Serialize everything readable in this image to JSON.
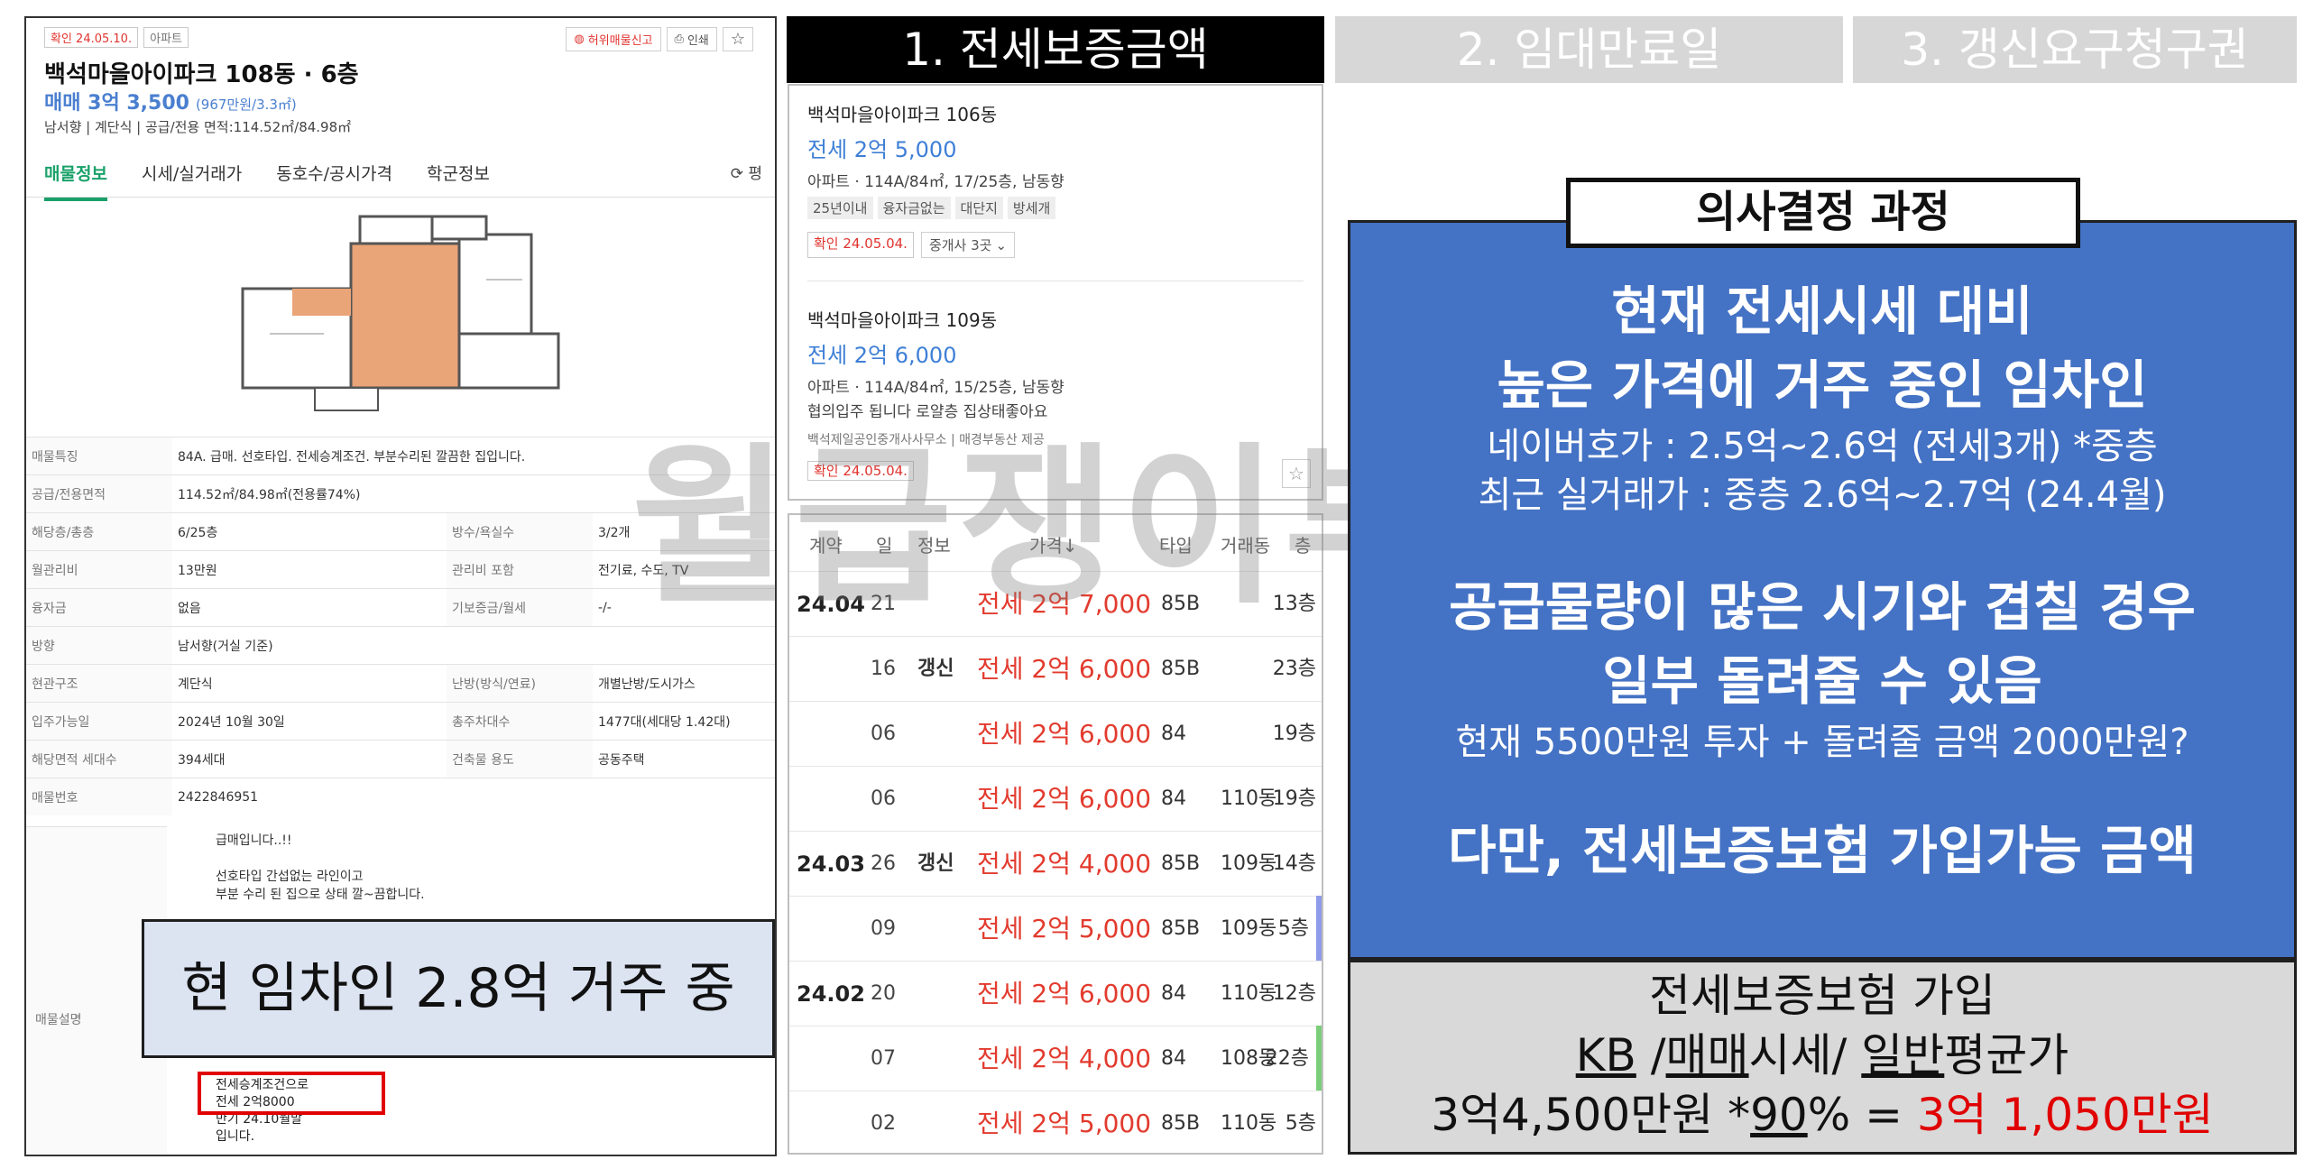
{
  "steps": {
    "s1": "1. 전세보증금액",
    "s2": "2. 임대만료일",
    "s3": "3. 갱신요구청구권"
  },
  "listing": {
    "confirm_tag": "확인 24.05.10.",
    "type_tag": "아파트",
    "report_btn": "허위매물신고",
    "print_btn": "인쇄",
    "title": "백석마을아이파크 108동 · 6층",
    "price_label": "매매 3억 3,500",
    "price_unit": "(967만원/3.3㎡)",
    "summary": "남서향 | 계단식 | 공급/전용 면적:114.52㎡/84.98㎡",
    "tabs": [
      "매물정보",
      "시세/실거래가",
      "동호수/공시가격",
      "학군정보"
    ],
    "tab_right": "평",
    "rows": [
      {
        "k": "매물특징",
        "v": "84A. 급매. 선호타입. 전세승계조건. 부분수리된 깔끔한 집입니다."
      },
      {
        "k": "공급/전용면적",
        "v": "114.52㎡/84.98㎡(전용률74%)"
      },
      {
        "k": "해당층/총층",
        "v": "6/25층",
        "k2": "방수/욕실수",
        "v2": "3/2개"
      },
      {
        "k": "월관리비",
        "v": "13만원",
        "k2": "관리비 포함",
        "v2": "전기료, 수도, TV"
      },
      {
        "k": "융자금",
        "v": "없음",
        "k2": "기보증금/월세",
        "v2": "-/-"
      },
      {
        "k": "방향",
        "v": "남서향(거실 기준)"
      },
      {
        "k": "현관구조",
        "v": "계단식",
        "k2": "난방(방식/연료)",
        "v2": "개별난방/도시가스"
      },
      {
        "k": "입주가능일",
        "v": "2024년 10월 30일",
        "k2": "총주차대수",
        "v2": "1477대(세대당 1.42대)"
      },
      {
        "k": "해당면적 세대수",
        "v": "394세대",
        "k2": "건축물 용도",
        "v2": "공동주택"
      },
      {
        "k": "매물번호",
        "v": "2422846951"
      }
    ],
    "desc_label": "매물설명",
    "desc1": "급매입니다..!!",
    "desc2": "선호타입 간섭없는 라인이고",
    "desc3": "부분 수리 된 집으로 상태 깔~끔합니다.",
    "desc4": "전세승계조건으로",
    "desc5": "전세 2억8000",
    "desc6": "만기 24.10월말",
    "desc7": "입니다."
  },
  "tenant_note": "현 임차인 2.8억 거주 중",
  "listings": [
    {
      "title": "백석마을아이파크 106동",
      "price": "전세 2억 5,000",
      "meta": "아파트 · 114A/84㎡, 17/25층, 남동향",
      "chips": [
        "25년이내",
        "융자금없는",
        "대단지",
        "방세개"
      ],
      "confirm": "확인 24.05.04.",
      "agents": "중개사 3곳"
    },
    {
      "title": "백석마을아이파크 109동",
      "price": "전세 2억 6,000",
      "meta": "아파트 · 114A/84㎡, 15/25층, 남동향",
      "desc": "협의입주 됩니다 로얄층 집상태좋아요",
      "agent": "백석제일공인중개사사무소 | 매경부동산 제공",
      "confirm": "확인 24.05.04."
    }
  ],
  "deal_table": {
    "headers": [
      "계약",
      "일",
      "정보",
      "가격↓",
      "타입",
      "거래동",
      "층"
    ],
    "rows": [
      {
        "ym": "24.04",
        "d": "21",
        "info": "",
        "price": "전세 2억 7,000",
        "type": "85B",
        "dong": "",
        "fl": "13층"
      },
      {
        "ym": "",
        "d": "16",
        "info": "갱신",
        "price": "전세 2억 6,000",
        "type": "85B",
        "dong": "",
        "fl": "23층"
      },
      {
        "ym": "",
        "d": "06",
        "info": "",
        "price": "전세 2억 6,000",
        "type": "84",
        "dong": "",
        "fl": "19층"
      },
      {
        "ym": "",
        "d": "06",
        "info": "",
        "price": "전세 2억 6,000",
        "type": "84",
        "dong": "110동",
        "fl": "19층"
      },
      {
        "ym": "24.03",
        "d": "26",
        "info": "갱신",
        "price": "전세 2억 4,000",
        "type": "85B",
        "dong": "109동",
        "fl": "14층"
      },
      {
        "ym": "",
        "d": "09",
        "info": "",
        "price": "전세 2억 5,000",
        "type": "85B",
        "dong": "109동",
        "fl": "5층"
      },
      {
        "ym": "24.02",
        "d": "20",
        "info": "",
        "price": "전세 2억 6,000",
        "type": "84",
        "dong": "110동",
        "fl": "12층"
      },
      {
        "ym": "",
        "d": "07",
        "info": "",
        "price": "전세 2억 4,000",
        "type": "84",
        "dong": "108동",
        "fl": "22층"
      },
      {
        "ym": "",
        "d": "02",
        "info": "",
        "price": "전세 2억 5,000",
        "type": "85B",
        "dong": "110동",
        "fl": "5층"
      }
    ]
  },
  "decision": {
    "label": "의사결정 과정",
    "h1": "현재 전세시세 대비",
    "h2": "높은 가격에 거주 중인 임차인",
    "s1": "네이버호가 : 2.5억~2.6억 (전세3개) *중층",
    "s2": "최근 실거래가 : 중층 2.6억~2.7억 (24.4월)",
    "h3": "공급물량이 많은 시기와 겹칠 경우",
    "h4": "일부 돌려줄 수 있음",
    "s3": "현재 5500만원 투자 + 돌려줄 금액 2000만원?",
    "h5": "다만, 전세보증보험 가입가능 금액"
  },
  "insurance": {
    "l1": "전세보증보험 가입",
    "kb": "KB",
    "sep1": " /",
    "maemae": "매매",
    "sise": "시세/ ",
    "ilban": "일반",
    "avg": "평균가",
    "calc_a": "3억4,500만원 *",
    "pct": "90",
    "calc_b": "% = ",
    "result": "3억 1,050만원"
  },
  "watermark": "월급쟁이부자들"
}
